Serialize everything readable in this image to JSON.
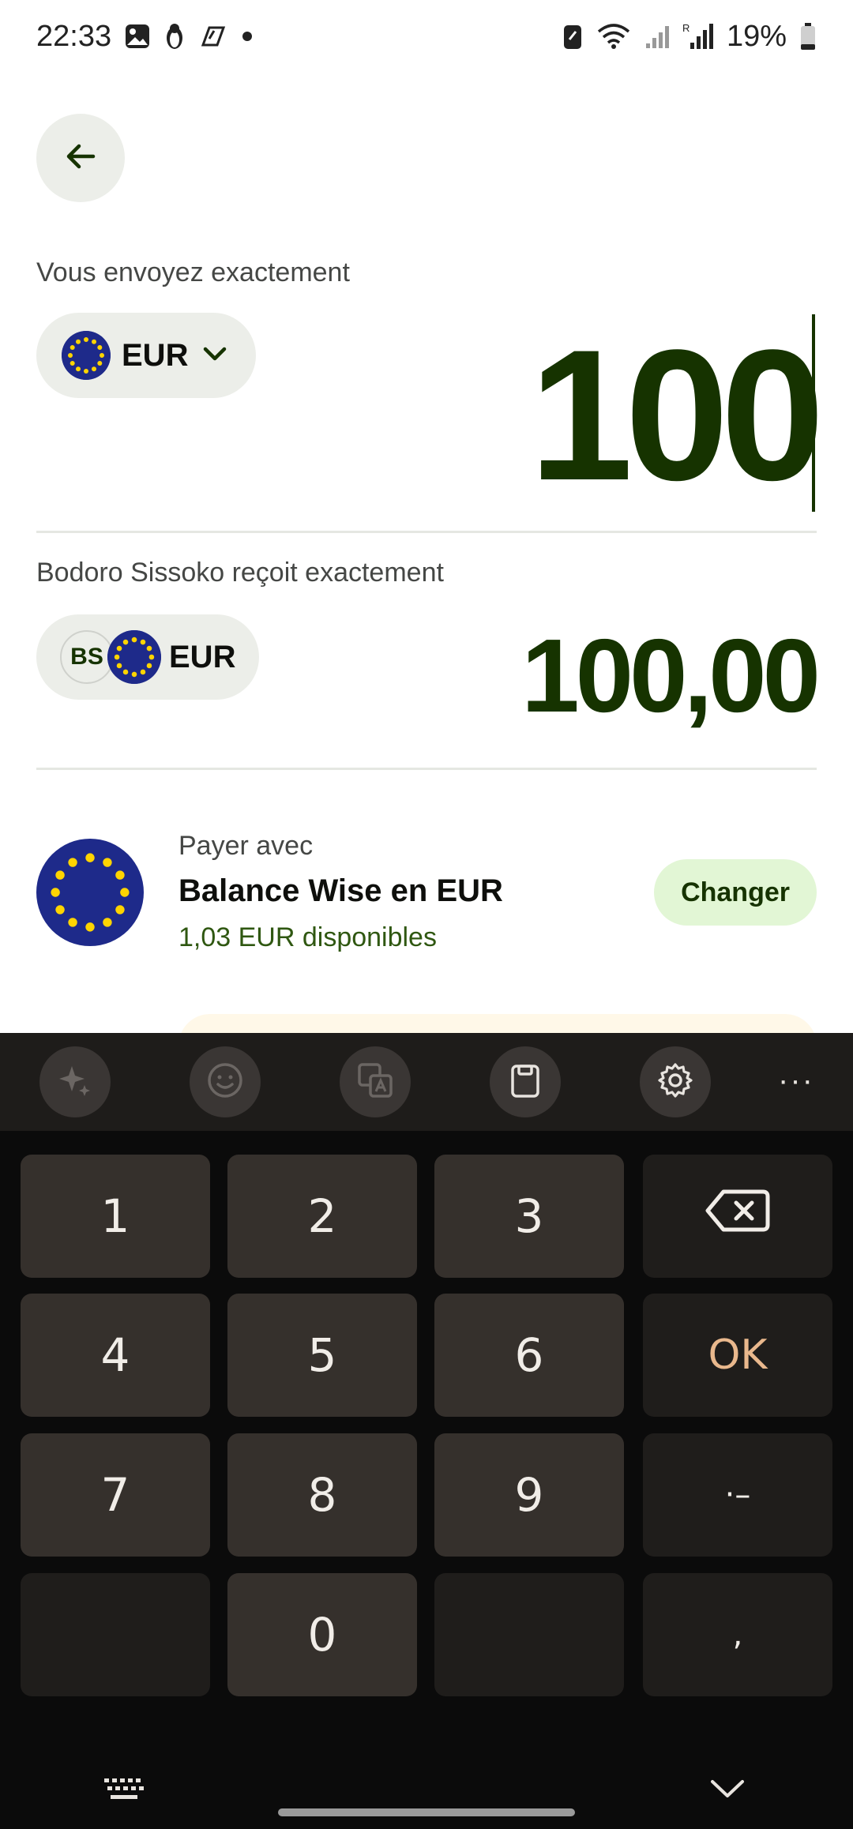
{
  "status_bar": {
    "time": "22:33",
    "battery": "19%",
    "network_label": "R"
  },
  "send": {
    "label": "Vous envoyez exactement",
    "currency": "EUR",
    "amount": "100"
  },
  "receive": {
    "label": "Bodoro Sissoko reçoit exactement",
    "recipient_initials": "BS",
    "currency": "EUR",
    "amount": "100,00"
  },
  "payment": {
    "label": "Payer avec",
    "title": "Balance Wise en EUR",
    "available": "1,03 EUR disponibles",
    "change_label": "Changer"
  },
  "keyboard": {
    "toolbar_more": "···",
    "keys": {
      "k1": "1",
      "k2": "2",
      "k3": "3",
      "k4": "4",
      "k5": "5",
      "k6": "6",
      "k7": "7",
      "k8": "8",
      "k9": "9",
      "k0": "0",
      "ok": "OK",
      "dot_dash": "·–",
      "comma": ","
    }
  },
  "colors": {
    "brand_dark_green": "#163300",
    "accent_light_green": "#e2f6d5",
    "eu_blue": "#1e2a8a",
    "eu_gold": "#ffd400",
    "keyboard_ok": "#e9b88d"
  },
  "icons": {
    "back": "arrow-left-icon",
    "dropdown": "chevron-down-icon",
    "backspace": "backspace-icon",
    "settings": "gear-icon",
    "clipboard": "clipboard-icon",
    "emoji": "emoji-icon",
    "translate": "translate-icon",
    "ai": "sparkle-icon"
  }
}
